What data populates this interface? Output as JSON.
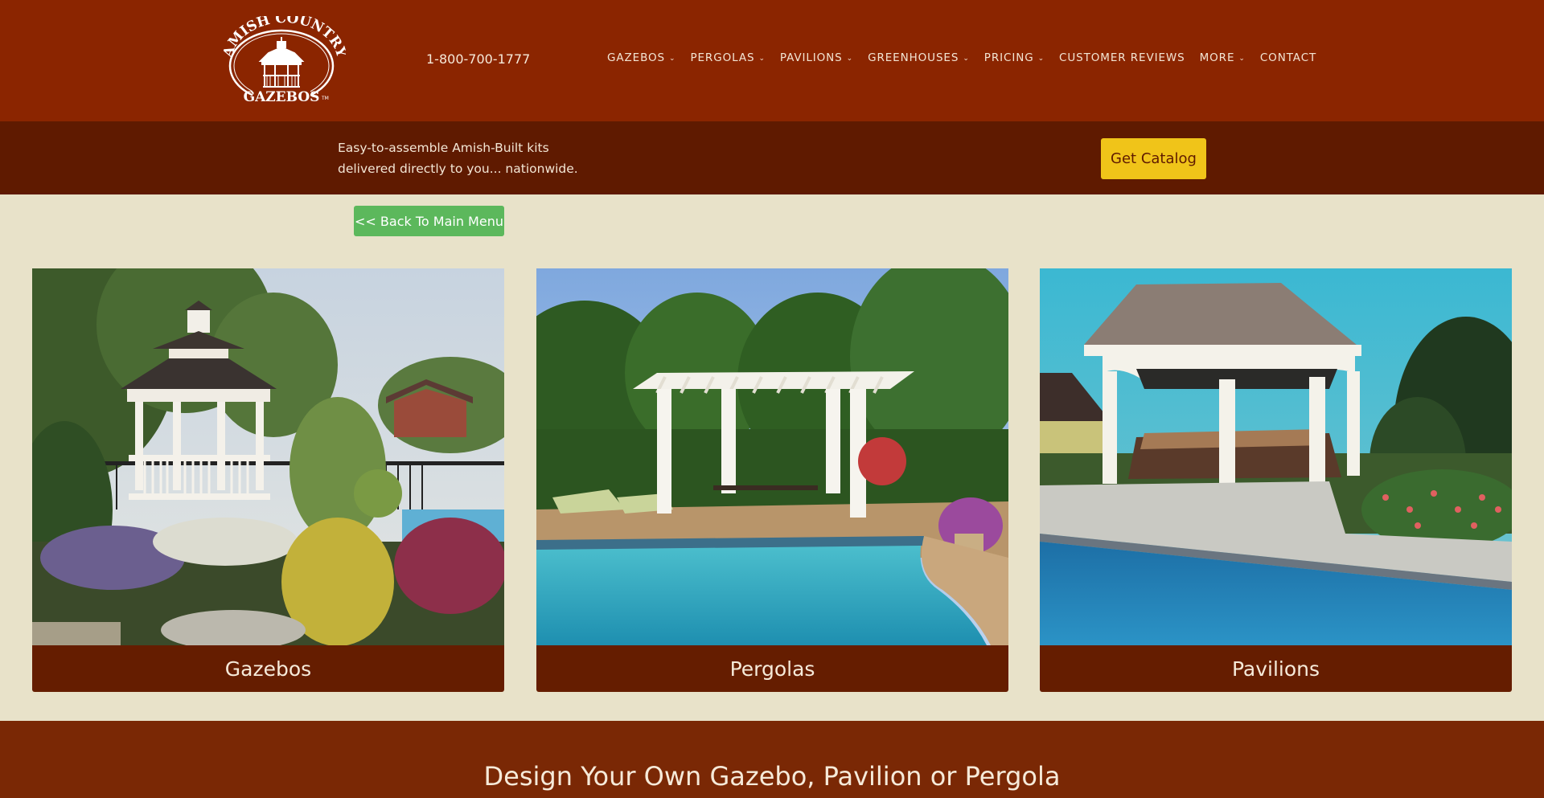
{
  "header": {
    "logo_alt": "Amish Country Gazebos",
    "logo_top_text": "AMISH COUNTRY",
    "logo_bottom_text": "GAZEBOS",
    "logo_tm": "TM",
    "phone": "1-800-700-1777",
    "nav": [
      {
        "label": "GAZEBOS",
        "has_dropdown": true,
        "icon": "chevron-down-icon"
      },
      {
        "label": "PERGOLAS",
        "has_dropdown": true,
        "icon": "chevron-down-icon"
      },
      {
        "label": "PAVILIONS",
        "has_dropdown": true,
        "icon": "chevron-down-icon"
      },
      {
        "label": "GREENHOUSES",
        "has_dropdown": true,
        "icon": "chevron-down-icon"
      },
      {
        "label": "PRICING",
        "has_dropdown": true,
        "icon": "chevron-down-icon"
      },
      {
        "label": "CUSTOMER REVIEWS",
        "has_dropdown": false
      },
      {
        "label": "MORE",
        "has_dropdown": true,
        "icon": "chevron-down-icon"
      },
      {
        "label": "CONTACT",
        "has_dropdown": false
      }
    ],
    "chevron_glyph": "⌄"
  },
  "subbar": {
    "tagline_line1": "Easy-to-assemble Amish-Built kits",
    "tagline_line2": "delivered directly to you... nationwide.",
    "catalog_button": "Get Catalog"
  },
  "back_button": "<< Back To Main Menu",
  "cards": [
    {
      "caption": "Gazebos",
      "image": "white octagonal gazebo in landscaped garden"
    },
    {
      "caption": "Pergolas",
      "image": "white pergola beside swimming pool"
    },
    {
      "caption": "Pavilions",
      "image": "hip-roof pavilion beside swimming pool"
    }
  ],
  "design_section": {
    "title": "Design Your Own Gazebo, Pavilion or Pergola"
  },
  "colors": {
    "header_bg": "#8b2500",
    "subbar_bg": "#5f1a00",
    "page_bg": "#e8e2c9",
    "caption_bg": "#651d00",
    "catalog_button_bg": "#f0c419",
    "back_button_bg": "#5cb85c",
    "design_band_bg": "#7a2805"
  }
}
